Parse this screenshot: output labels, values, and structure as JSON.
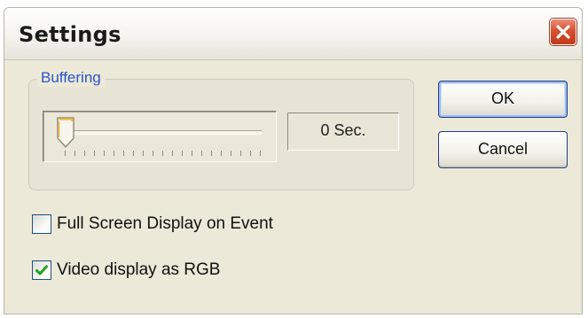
{
  "window": {
    "title": "Settings",
    "close_icon": "close-x-icon"
  },
  "buffering": {
    "group_label": "Buffering",
    "slider_value": 0,
    "value_text": "0 Sec."
  },
  "buttons": {
    "ok_label": "OK",
    "cancel_label": "Cancel"
  },
  "options": [
    {
      "label": "Full Screen Display on Event",
      "checked": false
    },
    {
      "label": "Video display as RGB",
      "checked": true
    }
  ],
  "colors": {
    "dialog_bg": "#ece9d8",
    "group_label": "#2a54c9",
    "close_button": "#d9502f",
    "checkmark": "#21a121",
    "default_button_border": "#1f3f86"
  }
}
